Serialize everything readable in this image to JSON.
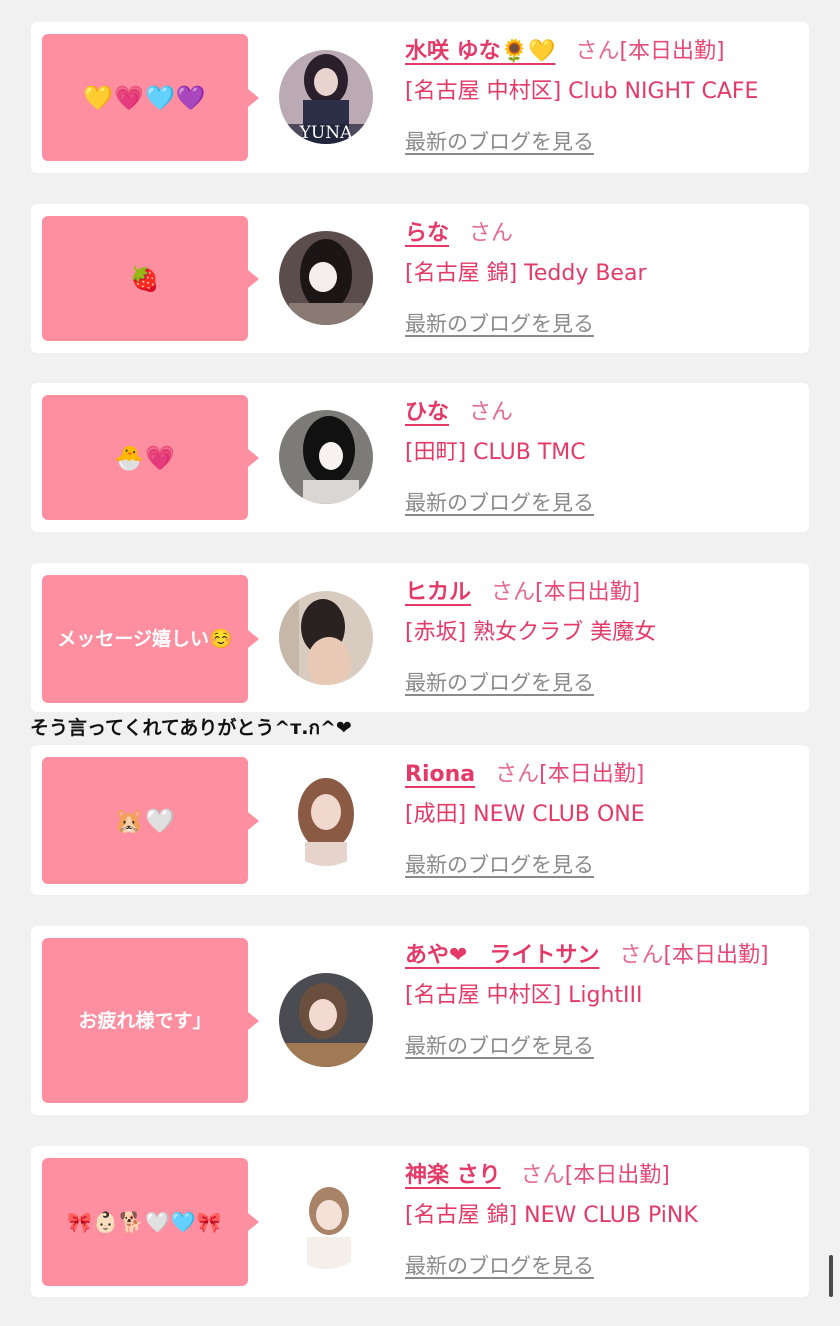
{
  "entries": [
    {
      "message": "💛💗🩵💜",
      "name": "水咲 ゆな🌻💛",
      "san": "さん",
      "status": "[本日出勤]",
      "shop": "[名古屋 中村区] Club NIGHT CAFE",
      "blog": "最新のブログを見る",
      "avatar_caption": "YUNA"
    },
    {
      "message": "🍓",
      "name": "らな",
      "san": "さん",
      "status": "",
      "shop": "[名古屋 錦] Teddy Bear",
      "blog": "最新のブログを見る",
      "avatar_caption": ""
    },
    {
      "message": "🐣💗",
      "name": "ひな",
      "san": "さん",
      "status": "",
      "shop": "[田町] CLUB TMC",
      "blog": "最新のブログを見る",
      "avatar_caption": ""
    },
    {
      "message": "メッセージ嬉しい☺️",
      "name": "ヒカル",
      "san": "さん",
      "status": "[本日出勤]",
      "shop": "[赤坂] 熟女クラブ 美魔女",
      "blog": "最新のブログを見る",
      "avatar_caption": ""
    },
    {
      "message": "🐹🤍",
      "name": "Riona",
      "san": "さん",
      "status": "[本日出勤]",
      "shop": "[成田] NEW CLUB ONE",
      "blog": "最新のブログを見る",
      "avatar_caption": ""
    },
    {
      "message": "お疲れ様です」",
      "name": "あや❤︎　ライトサン",
      "san": "さん",
      "status": "[本日出勤]",
      "shop": "[名古屋 中村区] LightIII",
      "blog": "最新のブログを見る",
      "avatar_caption": ""
    },
    {
      "message": "🎀👶🏻🐕🤍🩵🎀",
      "name": "神楽 さり",
      "san": "さん",
      "status": "[本日出勤]",
      "shop": "[名古屋 錦] NEW CLUB PiNK",
      "blog": "最新のブログを見る",
      "avatar_caption": ""
    }
  ],
  "reply_overlay": "そう言ってくれてありがとう^ᴛ.ก^❤︎",
  "colors": {
    "bubble": "#fd8fa0",
    "name": "#e43a68",
    "background": "#f1f1f1"
  }
}
